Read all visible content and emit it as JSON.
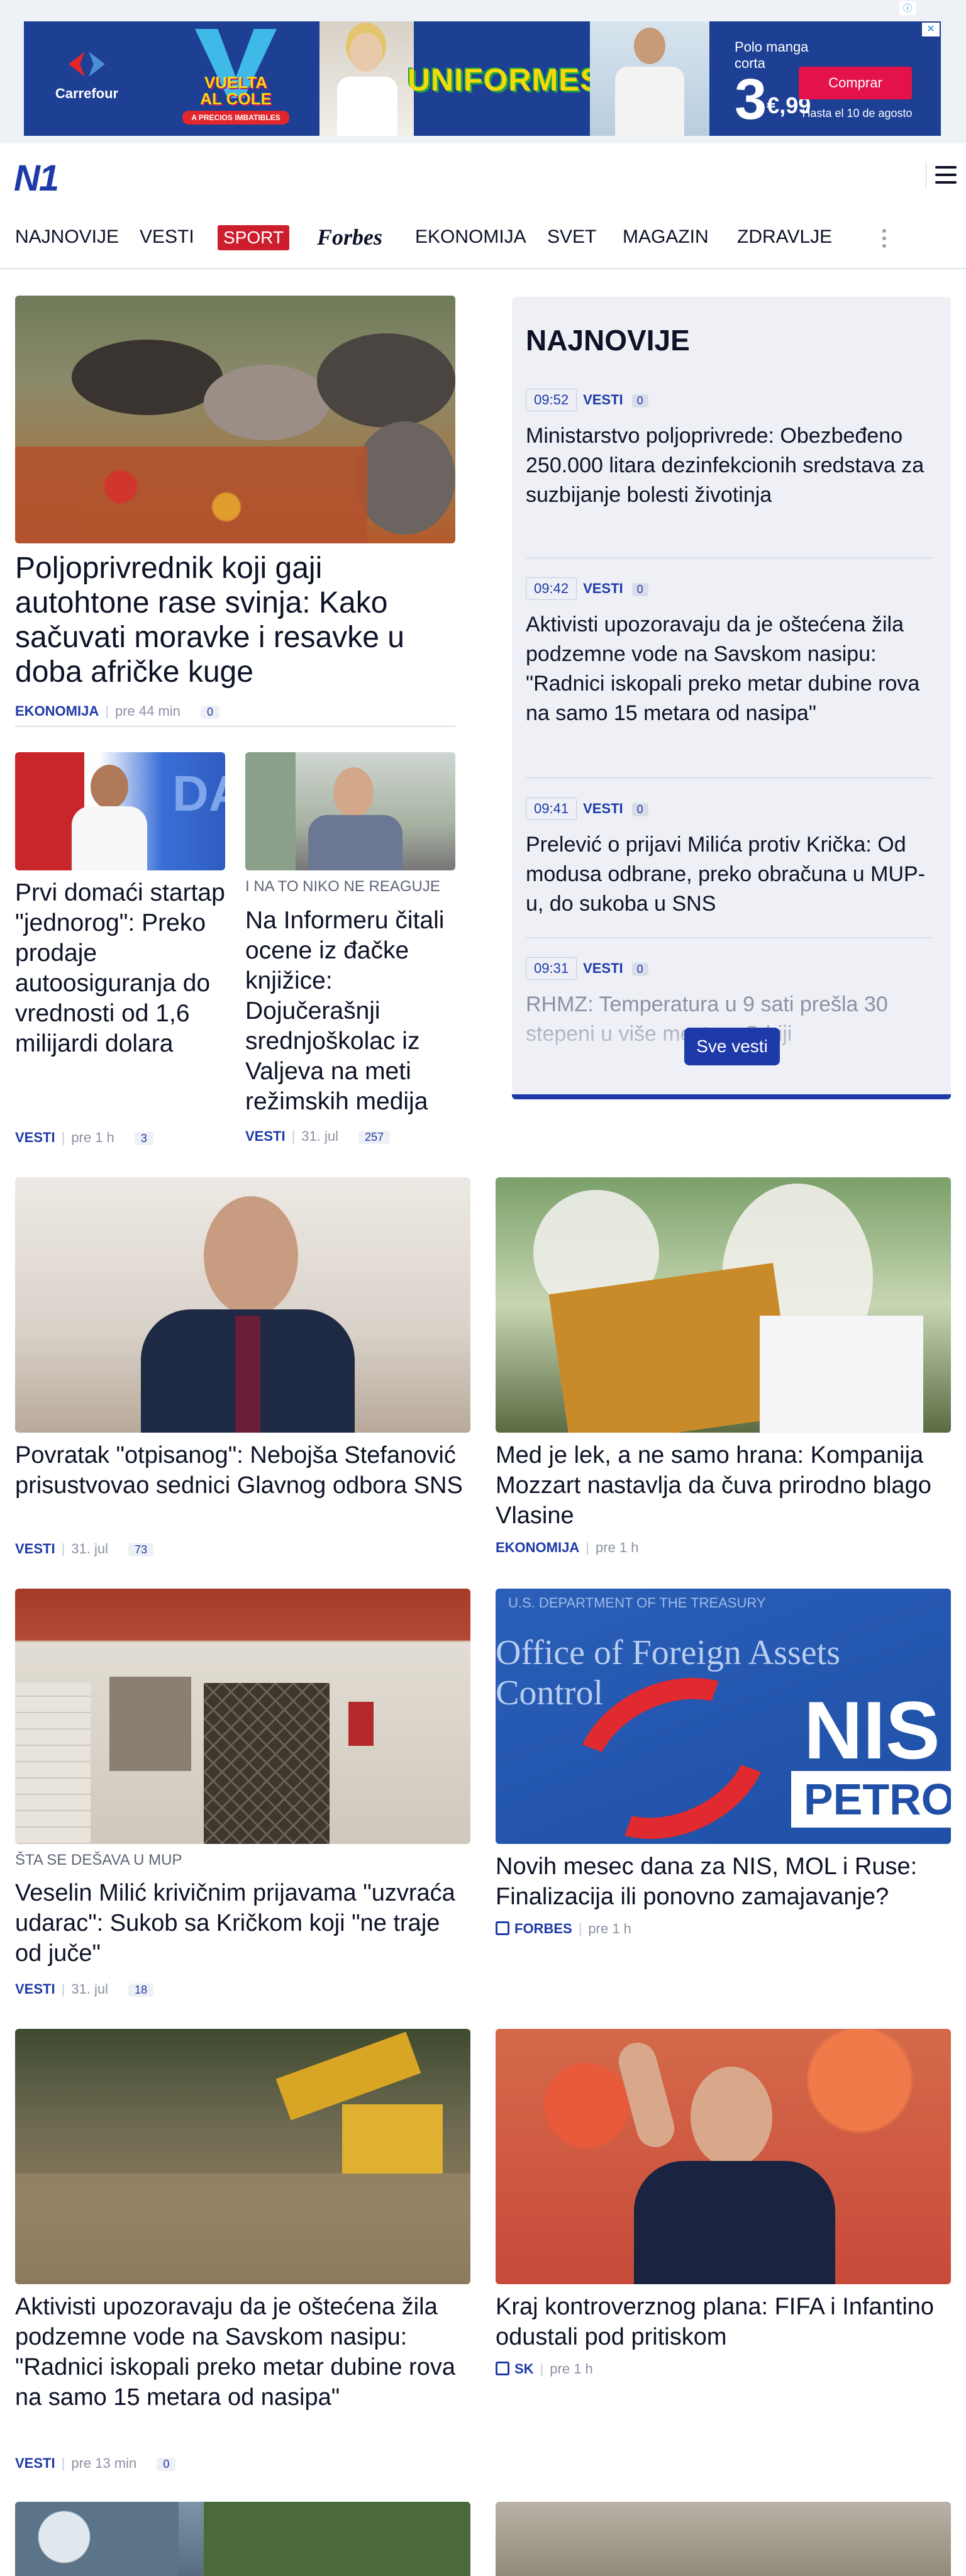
{
  "ad": {
    "brand": "Carrefour",
    "vuelta_line1": "VUELTA",
    "vuelta_line2": "AL COLE",
    "vuelta_sub": "A PRECIOS IMBATIBLES",
    "uniformes": "UNIFORMES",
    "price_label": "Polo manga corta",
    "price_int": "3",
    "price_cents": "€,99",
    "cta": "Comprar",
    "until": "Hasta el 10 de agosto"
  },
  "header": {
    "logo": "N1"
  },
  "nav": {
    "items": [
      "NAJNOVIJE",
      "VESTI",
      "SPORT",
      "Forbes",
      "EKONOMIJA",
      "SVET",
      "MAGAZIN",
      "ZDRAVLJE"
    ]
  },
  "lead": {
    "title": "Poljoprivrednik koji gaji autohtone rase svinja: Kako sačuvati moravke i resavke u doba afričke kuge",
    "category": "EKONOMIJA",
    "time": "pre 44 min",
    "comments": "0"
  },
  "small_1": {
    "title": "Prvi domaći startap \"jednorog\": Preko prodaje autoosiguranja do vrednosti od 1,6 milijardi dolara",
    "category": "VESTI",
    "time": "pre 1 h",
    "comments": "3"
  },
  "small_2": {
    "kicker": "I NA TO NIKO NE REAGUJE",
    "title": "Na Informeru čitali ocene iz đačke knjižice: Dojučerašnji srednjoškolac iz Valjeva na meti režimskih medija",
    "category": "VESTI",
    "time": "31. jul",
    "comments": "257"
  },
  "najnovije": {
    "title": "NAJNOVIJE",
    "items": [
      {
        "time": "09:52",
        "category": "VESTI",
        "comments": "0",
        "title": "Ministarstvo poljoprivrede: Obezbeđeno 250.000 litara dezinfekcionih sredstava za suzbijanje bolesti životinja"
      },
      {
        "time": "09:42",
        "category": "VESTI",
        "comments": "0",
        "title": "Aktivisti upozoravaju da je oštećena žila podzemne vode na Savskom nasipu: \"Radnici iskopali preko metar dubine rova na samo 15 metara od nasipa\""
      },
      {
        "time": "09:41",
        "category": "VESTI",
        "comments": "0",
        "title": "Prelević o prijavi Milića protiv Kričkа: Od modusa odbrane, preko obračuna u MUP-u, do sukoba u SNS"
      },
      {
        "time": "09:31",
        "category": "VESTI",
        "comments": "0",
        "title": "RHMZ: Temperatura u 9 sati prešla 30 stepeni u više mesta u Srbiji"
      }
    ],
    "all_button": "Sve vesti"
  },
  "grid": [
    {
      "title": "Povratak \"otpisanog\": Nebojša Stefanović prisustvovao sednici Glavnog odbora SNS",
      "category": "VESTI",
      "time": "31. jul",
      "comments": "73",
      "kicker": ""
    },
    {
      "title": "Med je lek, a ne samo hrana: Kompanija Mozzart nastavlja da čuva prirodno blago Vlasine",
      "category": "EKONOMIJA",
      "time": "pre 1 h",
      "comments": "",
      "kicker": ""
    },
    {
      "title": "Veselin Milić krivičnim prijavama \"uzvraća udarac\": Sukob sa Kričkom koji \"ne traje od juče\"",
      "category": "VESTI",
      "time": "31. jul",
      "comments": "18",
      "kicker": "ŠTA SE DEŠAVA U MUP"
    },
    {
      "title": "Novih mesec dana za NIS, MOL i Ruse: Finalizacija ili ponovno zamajavanje?",
      "category": "FORBES",
      "time": "pre 1 h",
      "comments": "",
      "kicker": ""
    },
    {
      "title": "Aktivisti upozoravaju da je oštećena žila podzemne vode na Savskom nasipu: \"Radnici iskopali preko metar dubine rova na samo 15 metara od nasipa\"",
      "category": "VESTI",
      "time": "pre 13 min",
      "comments": "0",
      "kicker": ""
    },
    {
      "title": "Kraj kontroverznog plana: FIFA i Infantino odustali pod pritiskom",
      "category": "SK",
      "time": "pre 1 h",
      "comments": "",
      "kicker": ""
    }
  ],
  "colors": {
    "brand_blue": "#1e3aa8",
    "sport_red": "#cc1e2c",
    "sidebar_bg": "#eef0f6"
  }
}
